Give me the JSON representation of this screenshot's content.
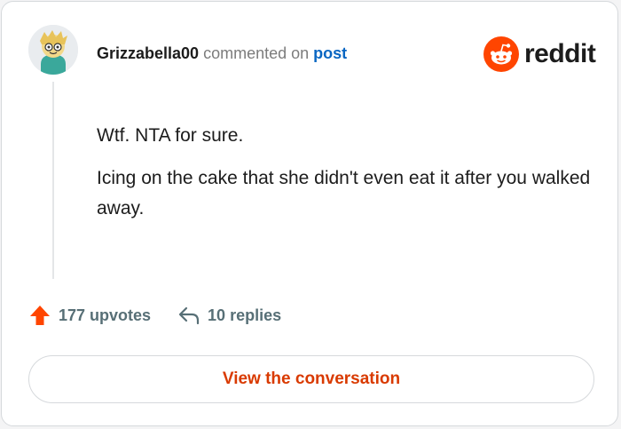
{
  "comment": {
    "username": "Grizzabella00",
    "action_text": " commented on ",
    "post_link": "post",
    "paragraphs": [
      "Wtf. NTA for sure.",
      "Icing on the cake that she didn't even eat it after you walked away."
    ]
  },
  "brand": {
    "name": "reddit",
    "icon": "reddit-snoo-icon",
    "color": "#ff4500"
  },
  "actions": {
    "upvotes": "177 upvotes",
    "replies": "10 replies",
    "upvote_icon": "upvote-arrow-icon",
    "reply_icon": "reply-arrow-icon",
    "upvote_color": "#ff4500"
  },
  "cta": {
    "label": "View the conversation",
    "color": "#d93a00"
  }
}
